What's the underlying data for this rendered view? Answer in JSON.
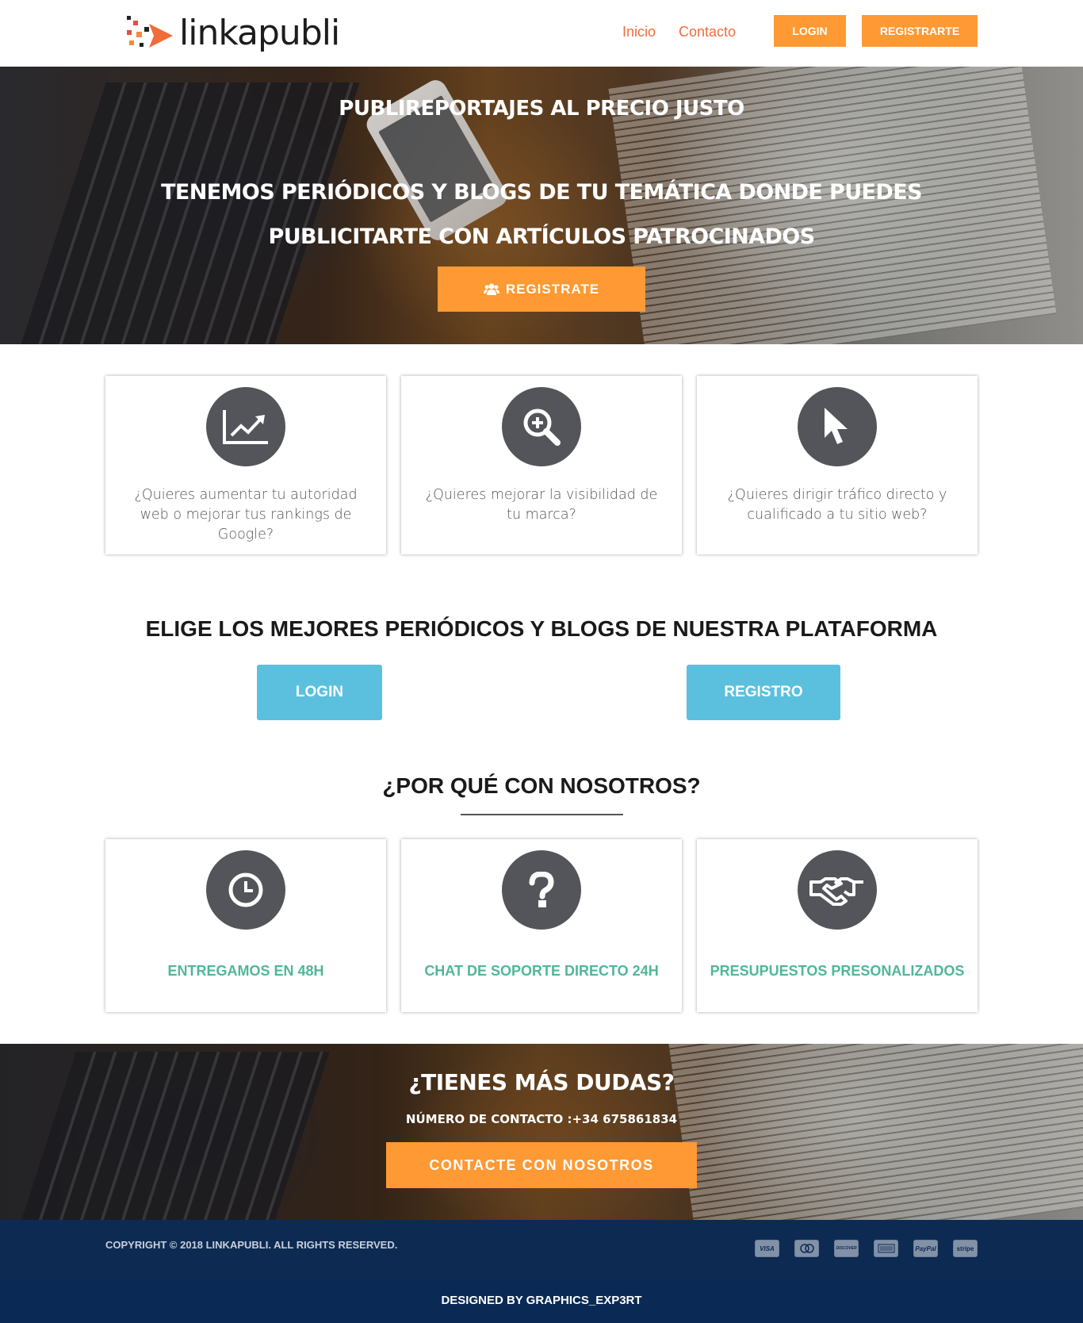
{
  "header": {
    "logo_text": "linkapubli",
    "nav": [
      "Inicio",
      "Contacto"
    ],
    "login_label": "LOGIN",
    "register_label": "REGISTRARTE"
  },
  "hero": {
    "title": "PUBLIREPORTAJES AL PRECIO JUSTO",
    "subtitle_line1": "TENEMOS PERIÓDICOS Y BLOGS DE TU TEMÁTICA DONDE PUEDES",
    "subtitle_line2": "PUBLICITARTE CON ARTÍCULOS PATROCINADOS",
    "button_label": "REGISTRATE"
  },
  "features": [
    {
      "icon": "trend-chart-icon",
      "text": "¿Quieres aumentar tu autoridad web o mejorar tus rankings de Google?"
    },
    {
      "icon": "zoom-in-icon",
      "text": "¿Quieres mejorar la visibilidad de tu marca?"
    },
    {
      "icon": "cursor-icon",
      "text": "¿Quieres dirigir tráfico directo y cualificado a tu sitio web?"
    }
  ],
  "platform": {
    "title": "ELIGE LOS MEJORES PERIÓDICOS Y BLOGS DE NUESTRA PLATAFORMA",
    "login_label": "LOGIN",
    "register_label": "REGISTRO"
  },
  "why": {
    "title": "¿POR QUÉ CON NOSOTROS?",
    "items": [
      {
        "icon": "clock-icon",
        "label": "ENTREGAMOS EN 48H"
      },
      {
        "icon": "question-icon",
        "label": "CHAT DE SOPORTE DIRECTO 24H"
      },
      {
        "icon": "handshake-icon",
        "label": "PRESUPUESTOS PRESONALIZADOS"
      }
    ]
  },
  "cta": {
    "title": "¿TIENES MÁS DUDAS?",
    "phone_text": "NÚMERO DE CONTACTO :+34 675861834",
    "button_label": "CONTACTE CON NOSOTROS"
  },
  "footer": {
    "copyright": "COPYRIGHT © 2018 LINKAPUBLI. ALL RIGHTS RESERVED.",
    "payments": [
      "VISA",
      "",
      "DISCOVER",
      "",
      "PayPal",
      "stripe"
    ],
    "designed_by": "DESIGNED BY GRAPHICS_EXP3RT"
  },
  "colors": {
    "accent_orange": "#ff9933",
    "nav_link": "#f06d3d",
    "info_blue": "#5bc0de",
    "feature_green": "#4fb79a",
    "icon_circle": "#54555b",
    "footer_bg": "#0d2b52"
  }
}
